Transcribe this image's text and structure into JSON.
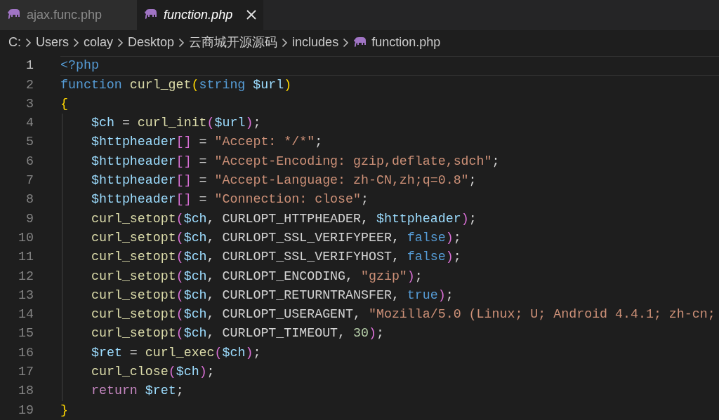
{
  "tabs": [
    {
      "label": "ajax.func.php",
      "selected": false,
      "preview": false
    },
    {
      "label": "function.php",
      "selected": true,
      "preview": true
    }
  ],
  "breadcrumb": [
    {
      "label": "C:",
      "kind": "folder"
    },
    {
      "label": "Users",
      "kind": "folder"
    },
    {
      "label": "colay",
      "kind": "folder"
    },
    {
      "label": "Desktop",
      "kind": "folder"
    },
    {
      "label": "云商城开源源码",
      "kind": "folder"
    },
    {
      "label": "includes",
      "kind": "folder"
    },
    {
      "label": "function.php",
      "kind": "file"
    }
  ],
  "editor": {
    "lines": [
      {
        "number": "1",
        "current": true,
        "indented": false,
        "tokens": [
          {
            "kind": "keyword",
            "text": "<?php"
          }
        ]
      },
      {
        "number": "2",
        "current": false,
        "indented": false,
        "tokens": [
          {
            "kind": "keyword",
            "text": "function "
          },
          {
            "kind": "function",
            "text": "curl_get"
          },
          {
            "kind": "bracket1",
            "text": "("
          },
          {
            "kind": "keyword",
            "text": "string "
          },
          {
            "kind": "variable",
            "text": "$url"
          },
          {
            "kind": "bracket1",
            "text": ")"
          }
        ]
      },
      {
        "number": "3",
        "current": false,
        "indented": false,
        "tokens": [
          {
            "kind": "bracket1",
            "text": "{"
          }
        ]
      },
      {
        "number": "4",
        "current": false,
        "indented": true,
        "tokens": [
          {
            "kind": "variable",
            "text": "$ch"
          },
          {
            "kind": "plain",
            "text": " = "
          },
          {
            "kind": "function",
            "text": "curl_init"
          },
          {
            "kind": "bracket2",
            "text": "("
          },
          {
            "kind": "variable",
            "text": "$url"
          },
          {
            "kind": "bracket2",
            "text": ")"
          },
          {
            "kind": "plain",
            "text": ";"
          }
        ]
      },
      {
        "number": "5",
        "current": false,
        "indented": true,
        "tokens": [
          {
            "kind": "variable",
            "text": "$httpheader"
          },
          {
            "kind": "bracket2",
            "text": "[]"
          },
          {
            "kind": "plain",
            "text": " = "
          },
          {
            "kind": "string",
            "text": "\"Accept: */*\""
          },
          {
            "kind": "plain",
            "text": ";"
          }
        ]
      },
      {
        "number": "6",
        "current": false,
        "indented": true,
        "tokens": [
          {
            "kind": "variable",
            "text": "$httpheader"
          },
          {
            "kind": "bracket2",
            "text": "[]"
          },
          {
            "kind": "plain",
            "text": " = "
          },
          {
            "kind": "string",
            "text": "\"Accept-Encoding: gzip,deflate,sdch\""
          },
          {
            "kind": "plain",
            "text": ";"
          }
        ]
      },
      {
        "number": "7",
        "current": false,
        "indented": true,
        "tokens": [
          {
            "kind": "variable",
            "text": "$httpheader"
          },
          {
            "kind": "bracket2",
            "text": "[]"
          },
          {
            "kind": "plain",
            "text": " = "
          },
          {
            "kind": "string",
            "text": "\"Accept-Language: zh-CN,zh;q=0.8\""
          },
          {
            "kind": "plain",
            "text": ";"
          }
        ]
      },
      {
        "number": "8",
        "current": false,
        "indented": true,
        "tokens": [
          {
            "kind": "variable",
            "text": "$httpheader"
          },
          {
            "kind": "bracket2",
            "text": "[]"
          },
          {
            "kind": "plain",
            "text": " = "
          },
          {
            "kind": "string",
            "text": "\"Connection: close\""
          },
          {
            "kind": "plain",
            "text": ";"
          }
        ]
      },
      {
        "number": "9",
        "current": false,
        "indented": true,
        "tokens": [
          {
            "kind": "function",
            "text": "curl_setopt"
          },
          {
            "kind": "bracket2",
            "text": "("
          },
          {
            "kind": "variable",
            "text": "$ch"
          },
          {
            "kind": "plain",
            "text": ", CURLOPT_HTTPHEADER, "
          },
          {
            "kind": "variable",
            "text": "$httpheader"
          },
          {
            "kind": "bracket2",
            "text": ")"
          },
          {
            "kind": "plain",
            "text": ";"
          }
        ]
      },
      {
        "number": "10",
        "current": false,
        "indented": true,
        "tokens": [
          {
            "kind": "function",
            "text": "curl_setopt"
          },
          {
            "kind": "bracket2",
            "text": "("
          },
          {
            "kind": "variable",
            "text": "$ch"
          },
          {
            "kind": "plain",
            "text": ", CURLOPT_SSL_VERIFYPEER, "
          },
          {
            "kind": "keyword",
            "text": "false"
          },
          {
            "kind": "bracket2",
            "text": ")"
          },
          {
            "kind": "plain",
            "text": ";"
          }
        ]
      },
      {
        "number": "11",
        "current": false,
        "indented": true,
        "tokens": [
          {
            "kind": "function",
            "text": "curl_setopt"
          },
          {
            "kind": "bracket2",
            "text": "("
          },
          {
            "kind": "variable",
            "text": "$ch"
          },
          {
            "kind": "plain",
            "text": ", CURLOPT_SSL_VERIFYHOST, "
          },
          {
            "kind": "keyword",
            "text": "false"
          },
          {
            "kind": "bracket2",
            "text": ")"
          },
          {
            "kind": "plain",
            "text": ";"
          }
        ]
      },
      {
        "number": "12",
        "current": false,
        "indented": true,
        "tokens": [
          {
            "kind": "function",
            "text": "curl_setopt"
          },
          {
            "kind": "bracket2",
            "text": "("
          },
          {
            "kind": "variable",
            "text": "$ch"
          },
          {
            "kind": "plain",
            "text": ", CURLOPT_ENCODING, "
          },
          {
            "kind": "string",
            "text": "\"gzip\""
          },
          {
            "kind": "bracket2",
            "text": ")"
          },
          {
            "kind": "plain",
            "text": ";"
          }
        ]
      },
      {
        "number": "13",
        "current": false,
        "indented": true,
        "tokens": [
          {
            "kind": "function",
            "text": "curl_setopt"
          },
          {
            "kind": "bracket2",
            "text": "("
          },
          {
            "kind": "variable",
            "text": "$ch"
          },
          {
            "kind": "plain",
            "text": ", CURLOPT_RETURNTRANSFER, "
          },
          {
            "kind": "keyword",
            "text": "true"
          },
          {
            "kind": "bracket2",
            "text": ")"
          },
          {
            "kind": "plain",
            "text": ";"
          }
        ]
      },
      {
        "number": "14",
        "current": false,
        "indented": true,
        "tokens": [
          {
            "kind": "function",
            "text": "curl_setopt"
          },
          {
            "kind": "bracket2",
            "text": "("
          },
          {
            "kind": "variable",
            "text": "$ch"
          },
          {
            "kind": "plain",
            "text": ", CURLOPT_USERAGENT, "
          },
          {
            "kind": "string",
            "text": "\"Mozilla/5.0 (Linux; U; Android 4.4.1; zh-cn;"
          }
        ]
      },
      {
        "number": "15",
        "current": false,
        "indented": true,
        "tokens": [
          {
            "kind": "function",
            "text": "curl_setopt"
          },
          {
            "kind": "bracket2",
            "text": "("
          },
          {
            "kind": "variable",
            "text": "$ch"
          },
          {
            "kind": "plain",
            "text": ", CURLOPT_TIMEOUT, "
          },
          {
            "kind": "number",
            "text": "30"
          },
          {
            "kind": "bracket2",
            "text": ")"
          },
          {
            "kind": "plain",
            "text": ";"
          }
        ]
      },
      {
        "number": "16",
        "current": false,
        "indented": true,
        "tokens": [
          {
            "kind": "variable",
            "text": "$ret"
          },
          {
            "kind": "plain",
            "text": " = "
          },
          {
            "kind": "function",
            "text": "curl_exec"
          },
          {
            "kind": "bracket2",
            "text": "("
          },
          {
            "kind": "variable",
            "text": "$ch"
          },
          {
            "kind": "bracket2",
            "text": ")"
          },
          {
            "kind": "plain",
            "text": ";"
          }
        ]
      },
      {
        "number": "17",
        "current": false,
        "indented": true,
        "tokens": [
          {
            "kind": "function",
            "text": "curl_close"
          },
          {
            "kind": "bracket2",
            "text": "("
          },
          {
            "kind": "variable",
            "text": "$ch"
          },
          {
            "kind": "bracket2",
            "text": ")"
          },
          {
            "kind": "plain",
            "text": ";"
          }
        ]
      },
      {
        "number": "18",
        "current": false,
        "indented": true,
        "tokens": [
          {
            "kind": "control",
            "text": "return "
          },
          {
            "kind": "variable",
            "text": "$ret"
          },
          {
            "kind": "plain",
            "text": ";"
          }
        ]
      },
      {
        "number": "19",
        "current": false,
        "indented": false,
        "tokens": [
          {
            "kind": "bracket1",
            "text": "}"
          }
        ]
      }
    ]
  }
}
